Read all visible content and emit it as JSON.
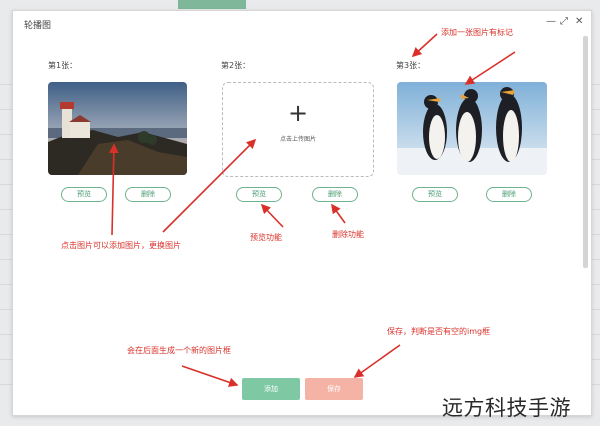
{
  "dialog": {
    "title": "轮播图",
    "controls": {
      "minimize": "—",
      "maximize": "⤢",
      "close": "✕"
    }
  },
  "slides": [
    {
      "label": "第1张：",
      "preview": "预览",
      "delete": "删除",
      "image": "lighthouse-photo"
    },
    {
      "label": "第2张：",
      "upload_plus": "+",
      "upload_text": "点击上传图片",
      "preview": "预览",
      "delete": "删除"
    },
    {
      "label": "第3张：",
      "preview": "预览",
      "delete": "删除",
      "image": "penguins-photo"
    }
  ],
  "annotations": {
    "add_marker": "添加一张图片有标记",
    "click_image": "点击图片可以添加图片，更换图片",
    "preview_feature": "预览功能",
    "delete_feature": "删除功能",
    "new_slot": "会在后面生成一个新的图片框",
    "save_check": "保存，判断是否有空的img框"
  },
  "actions": {
    "add": "添加",
    "save": "保存"
  },
  "watermark": "远方科技手游",
  "colors": {
    "accent": "#7ec9a4",
    "danger": "#f4b3a4",
    "annotation": "#d9312a",
    "button_border": "#6fb28e"
  }
}
